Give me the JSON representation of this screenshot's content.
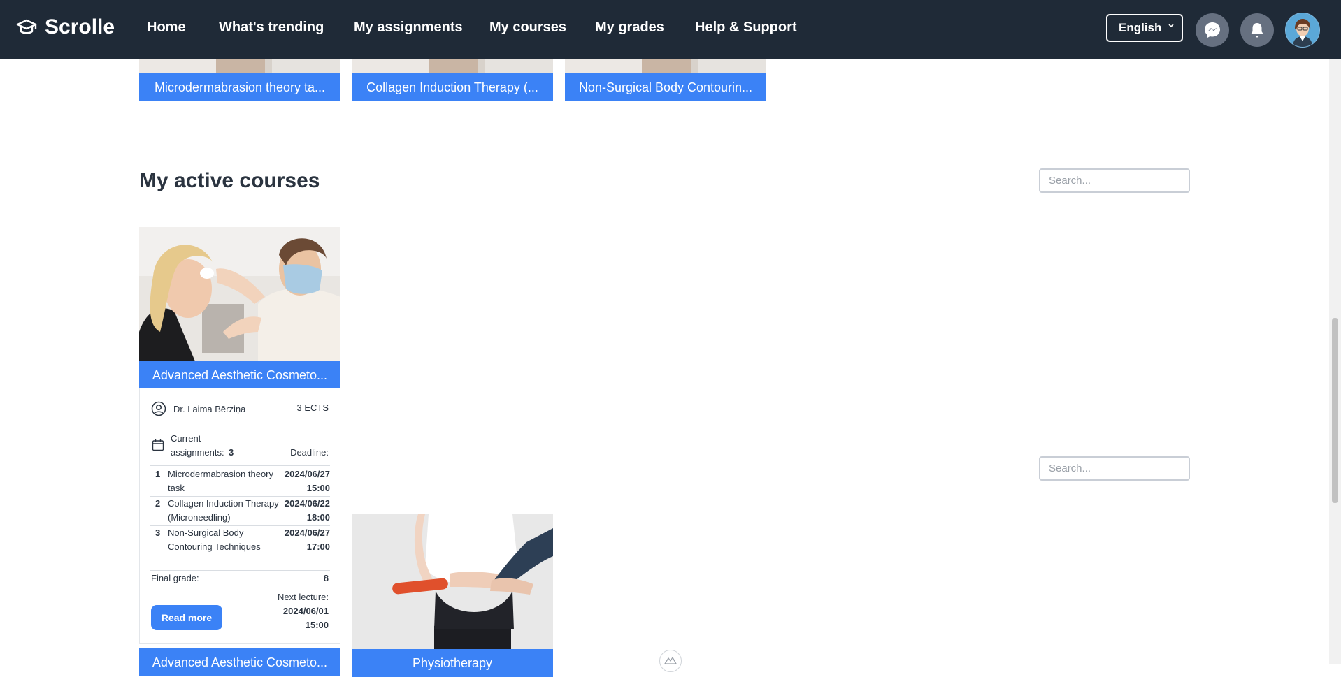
{
  "app": {
    "brand": "Scrolle"
  },
  "nav": {
    "home": "Home",
    "trending": "What's trending",
    "assignments": "My assignments",
    "courses": "My courses",
    "grades": "My grades",
    "help": "Help & Support"
  },
  "language": {
    "selected": "English"
  },
  "top_cards": [
    {
      "title": "Microdermabrasion theory ta..."
    },
    {
      "title": "Collagen Induction Therapy (..."
    },
    {
      "title": "Non-Surgical Body Contourin..."
    }
  ],
  "active_courses": {
    "heading": "My active courses",
    "search_placeholder": "Search...",
    "course": {
      "title": "Advanced Aesthetic Cosmeto...",
      "instructor": "Dr. Laima Bērziņa",
      "ects": "3 ECTS",
      "current_label": "Current",
      "assignments_label": "assignments:",
      "assignments_count": "3",
      "deadline_label": "Deadline:",
      "assignments": [
        {
          "num": "1",
          "name": "Microdermabrasion theory task",
          "date": "2024/06/27",
          "time": "15:00"
        },
        {
          "num": "2",
          "name": "Collagen Induction Therapy (Microneedling)",
          "date": "2024/06/22",
          "time": "18:00"
        },
        {
          "num": "3",
          "name": "Non-Surgical Body Contouring Techniques",
          "date": "2024/06/27",
          "time": "17:00"
        }
      ],
      "final_grade_label": "Final grade:",
      "final_grade": "8",
      "next_lecture_label": "Next lecture:",
      "next_lecture_date": "2024/06/01",
      "next_lecture_time": "15:00",
      "read_more": "Read more"
    }
  },
  "second_section": {
    "search_placeholder": "Search...",
    "cards": [
      {
        "title": "Advanced Aesthetic Cosmeto..."
      },
      {
        "title": "Physiotherapy"
      }
    ]
  },
  "colors": {
    "nav_bg": "#1f2a37",
    "accent": "#3b82f6",
    "text": "#2b3440"
  }
}
